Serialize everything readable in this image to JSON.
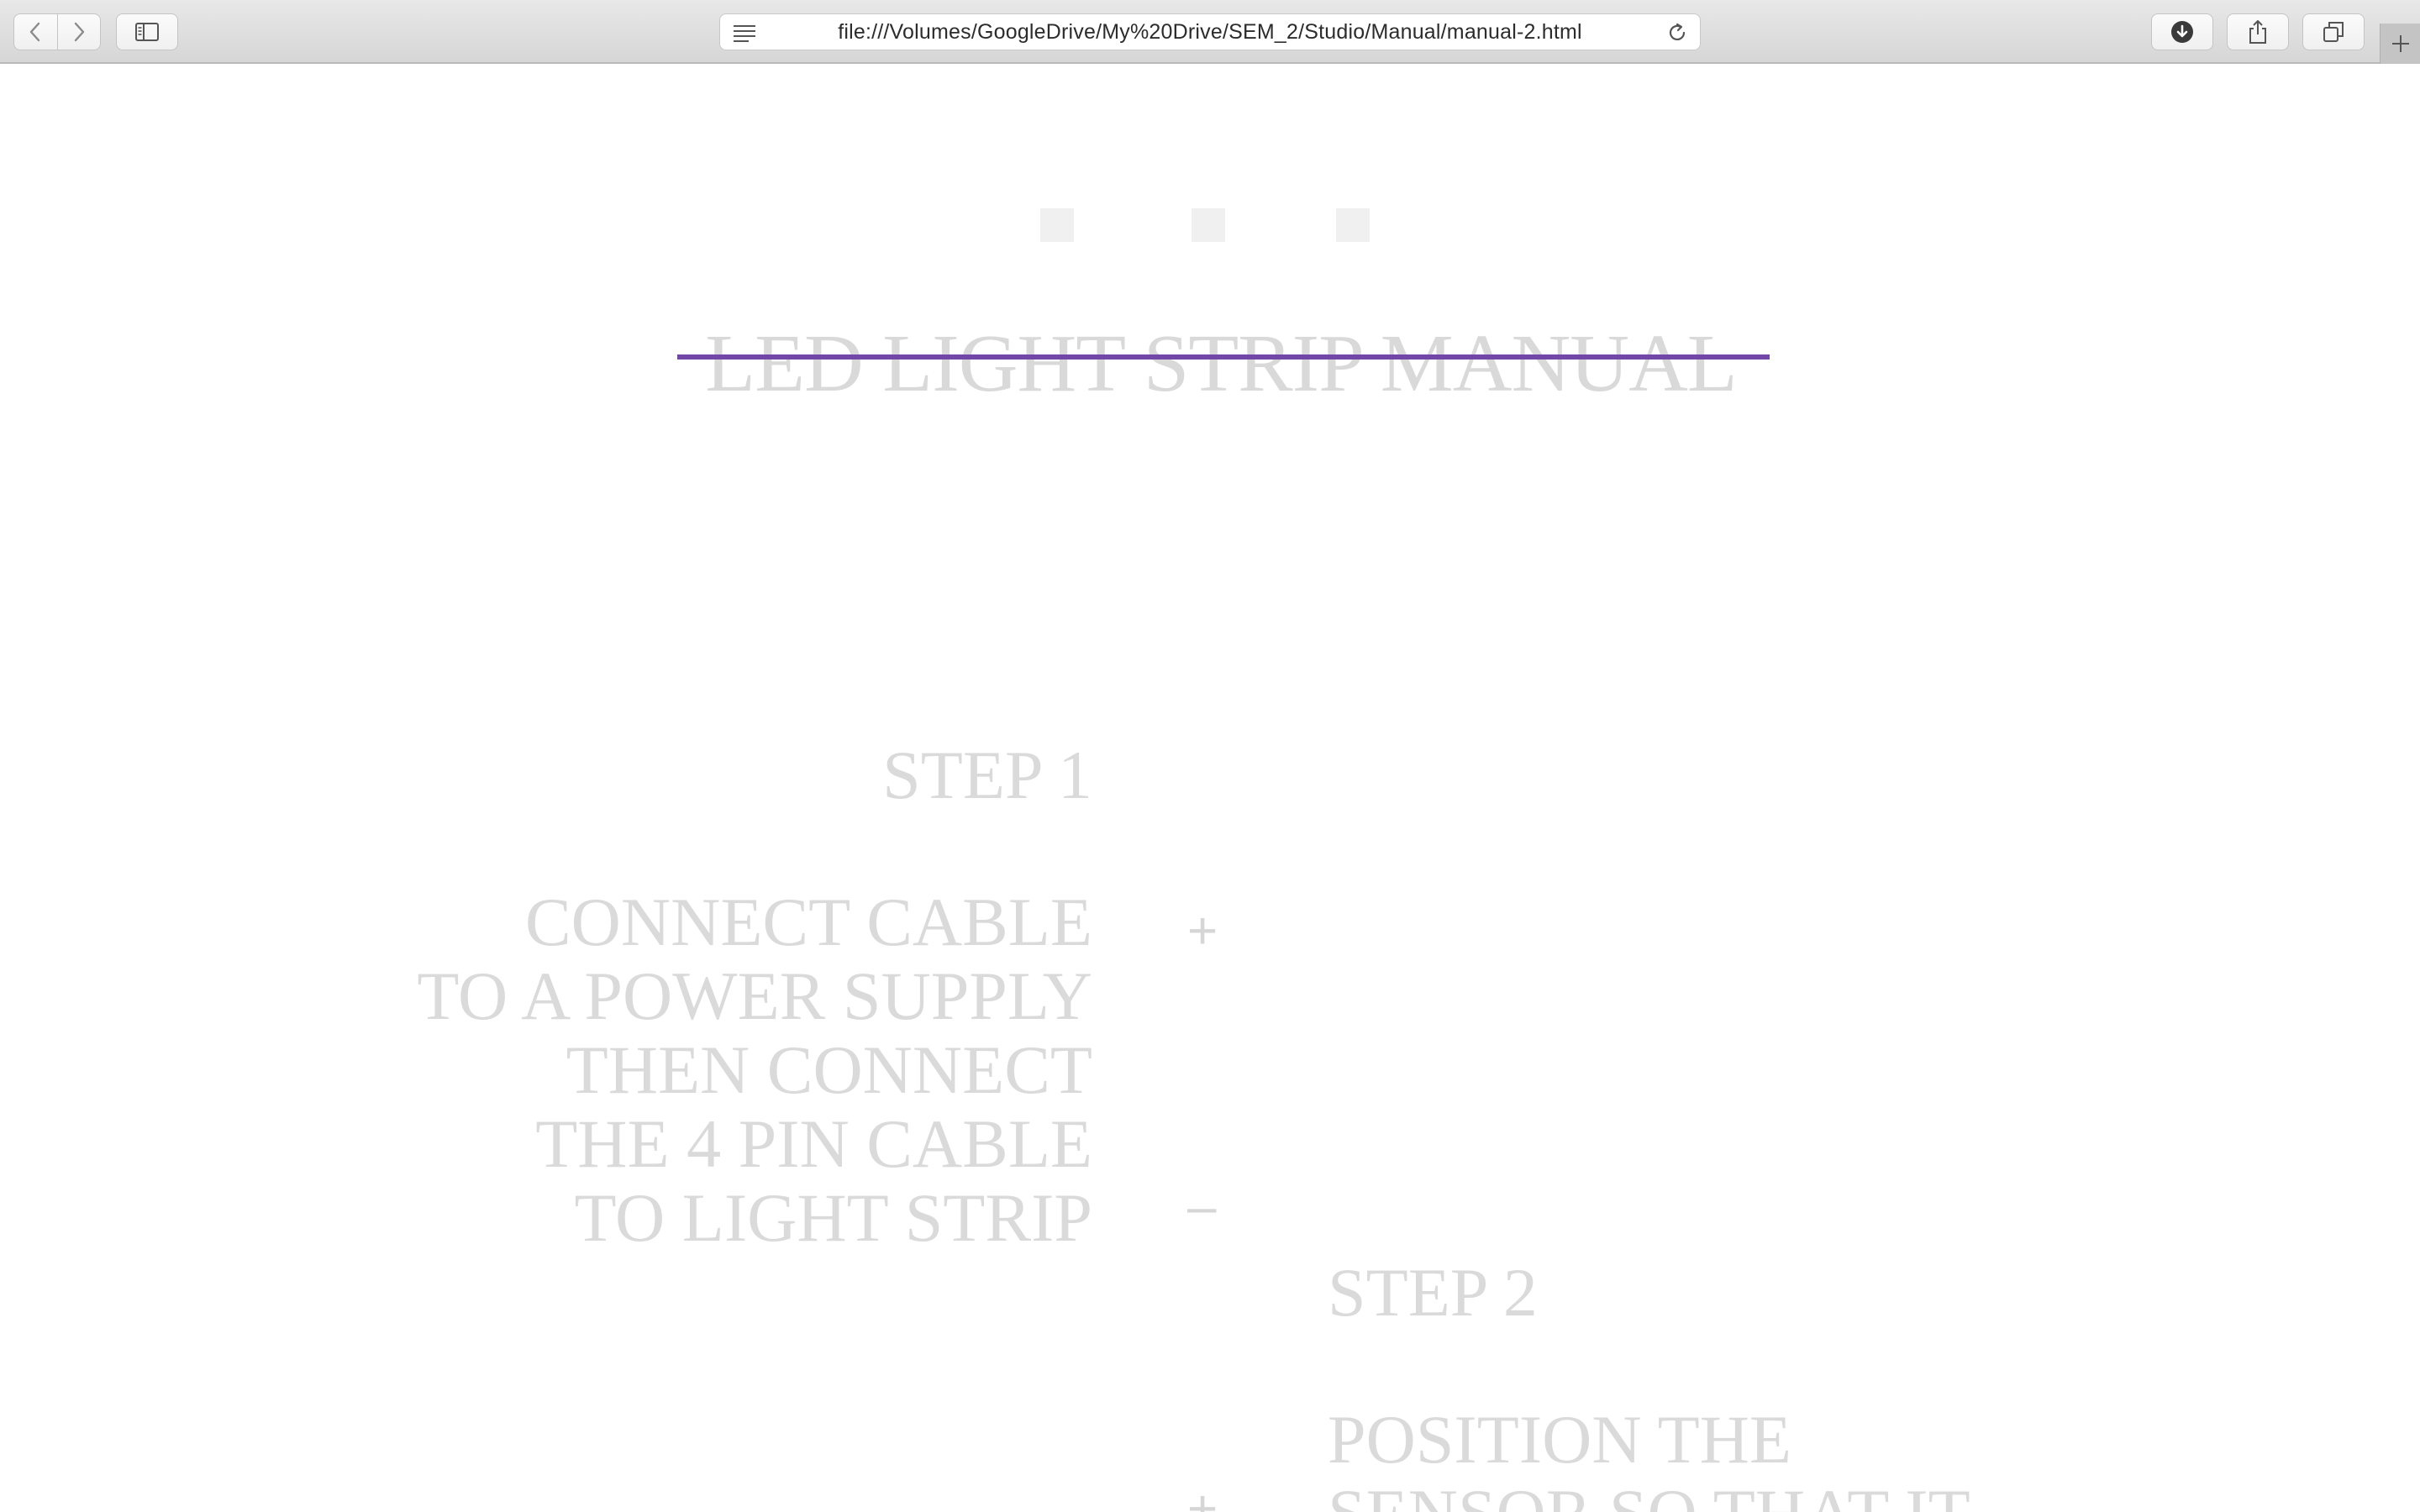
{
  "browser": {
    "url": "file:///Volumes/GoogleDrive/My%20Drive/SEM_2/Studio/Manual/manual-2.html",
    "icons": {
      "back": "chevron-left-icon",
      "forward": "chevron-right-icon",
      "sidebar": "sidebar-icon",
      "reader": "reader-icon",
      "reload": "reload-icon",
      "downloads": "download-icon",
      "share": "share-icon",
      "tabs": "tabs-icon",
      "new_tab": "plus-icon"
    }
  },
  "page": {
    "title": "LED LIGHT STRIP MANUAL",
    "accent_color": "#7347a7",
    "text_color": "#dadada",
    "step1": {
      "heading": "STEP 1",
      "text": "CONNECT CABLE\nTO A POWER SUPPLY\nTHEN CONNECT\nTHE 4 PIN CABLE\nTO LIGHT STRIP"
    },
    "step2": {
      "heading": "STEP 2",
      "text": "POSITION THE\nSENSOR SO THAT IT"
    },
    "symbols": {
      "plus": "+",
      "minus": "–"
    }
  }
}
